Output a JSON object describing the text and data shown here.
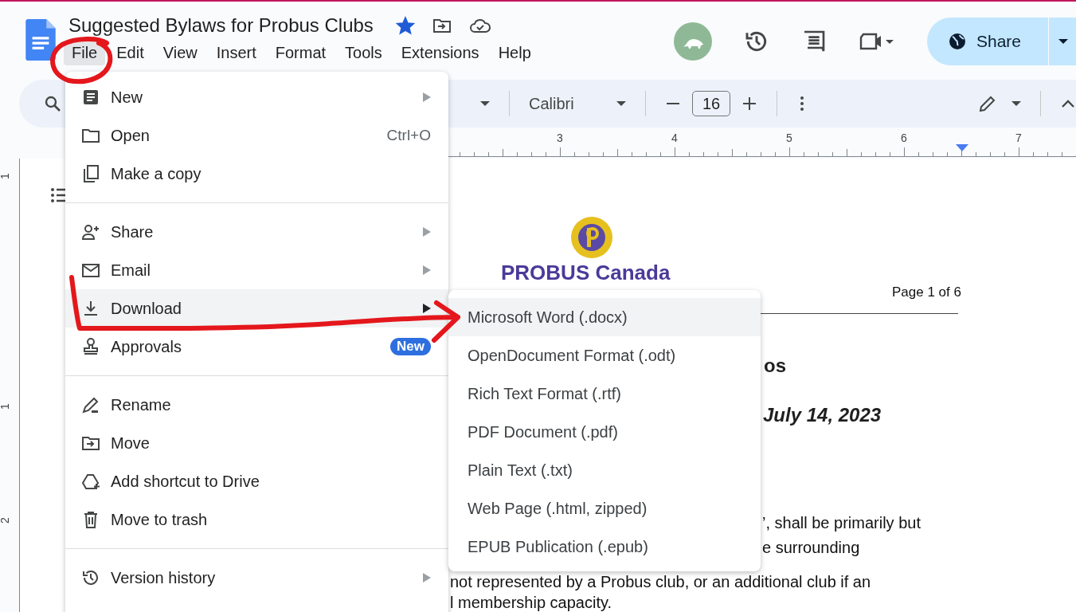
{
  "document_title": {
    "text": "Suggested Bylaws for Probus Clubs",
    "starred": true
  },
  "menu_bar": [
    {
      "label": "File",
      "selected": true
    },
    {
      "label": "Edit",
      "selected": false
    },
    {
      "label": "View",
      "selected": false
    },
    {
      "label": "Insert",
      "selected": false
    },
    {
      "label": "Format",
      "selected": false
    },
    {
      "label": "Tools",
      "selected": false
    },
    {
      "label": "Extensions",
      "selected": false
    },
    {
      "label": "Help",
      "selected": false
    }
  ],
  "share_button": "Share",
  "toolbar": {
    "font": "Calibri",
    "font_size": "16"
  },
  "ruler_numbers": [
    "3",
    "4",
    "5",
    "6",
    "7"
  ],
  "vertical_ruler_numbers": [
    "1",
    "1",
    "2"
  ],
  "document": {
    "logo_text": "PROBUS Canada",
    "page_number": "Page 1 of 6",
    "heading_fragment": "os",
    "date_fragment": "July 14, 2023",
    "lines": [
      "’, shall be primarily but",
      "e surrounding",
      "not represented by a Probus club, or an additional club if an",
      "l membership capacity."
    ]
  },
  "file_menu": [
    {
      "items": [
        {
          "label": "New",
          "has_submenu": true,
          "selected": false
        },
        {
          "label": "Open",
          "shortcut": "Ctrl+O",
          "has_submenu": false,
          "selected": false
        },
        {
          "label": "Make a copy",
          "has_submenu": false,
          "selected": false
        }
      ]
    },
    {
      "items": [
        {
          "label": "Share",
          "has_submenu": true,
          "selected": false
        },
        {
          "label": "Email",
          "has_submenu": true,
          "selected": false
        },
        {
          "label": "Download",
          "has_submenu": true,
          "selected": true
        },
        {
          "label": "Approvals",
          "badge": "New",
          "has_submenu": false,
          "selected": false
        }
      ]
    },
    {
      "items": [
        {
          "label": "Rename",
          "has_submenu": false,
          "selected": false
        },
        {
          "label": "Move",
          "has_submenu": false,
          "selected": false
        },
        {
          "label": "Add shortcut to Drive",
          "has_submenu": false,
          "selected": false
        },
        {
          "label": "Move to trash",
          "has_submenu": false,
          "selected": false
        }
      ]
    },
    {
      "items": [
        {
          "label": "Version history",
          "has_submenu": true,
          "selected": false
        }
      ]
    }
  ],
  "download_submenu": [
    {
      "label": "Microsoft Word (.docx)",
      "selected": true
    },
    {
      "label": "OpenDocument Format (.odt)",
      "selected": false
    },
    {
      "label": "Rich Text Format (.rtf)",
      "selected": false
    },
    {
      "label": "PDF Document (.pdf)",
      "selected": false
    },
    {
      "label": "Plain Text (.txt)",
      "selected": false
    },
    {
      "label": "Web Page (.html, zipped)",
      "selected": false
    },
    {
      "label": "EPUB Publication (.epub)",
      "selected": false
    }
  ]
}
